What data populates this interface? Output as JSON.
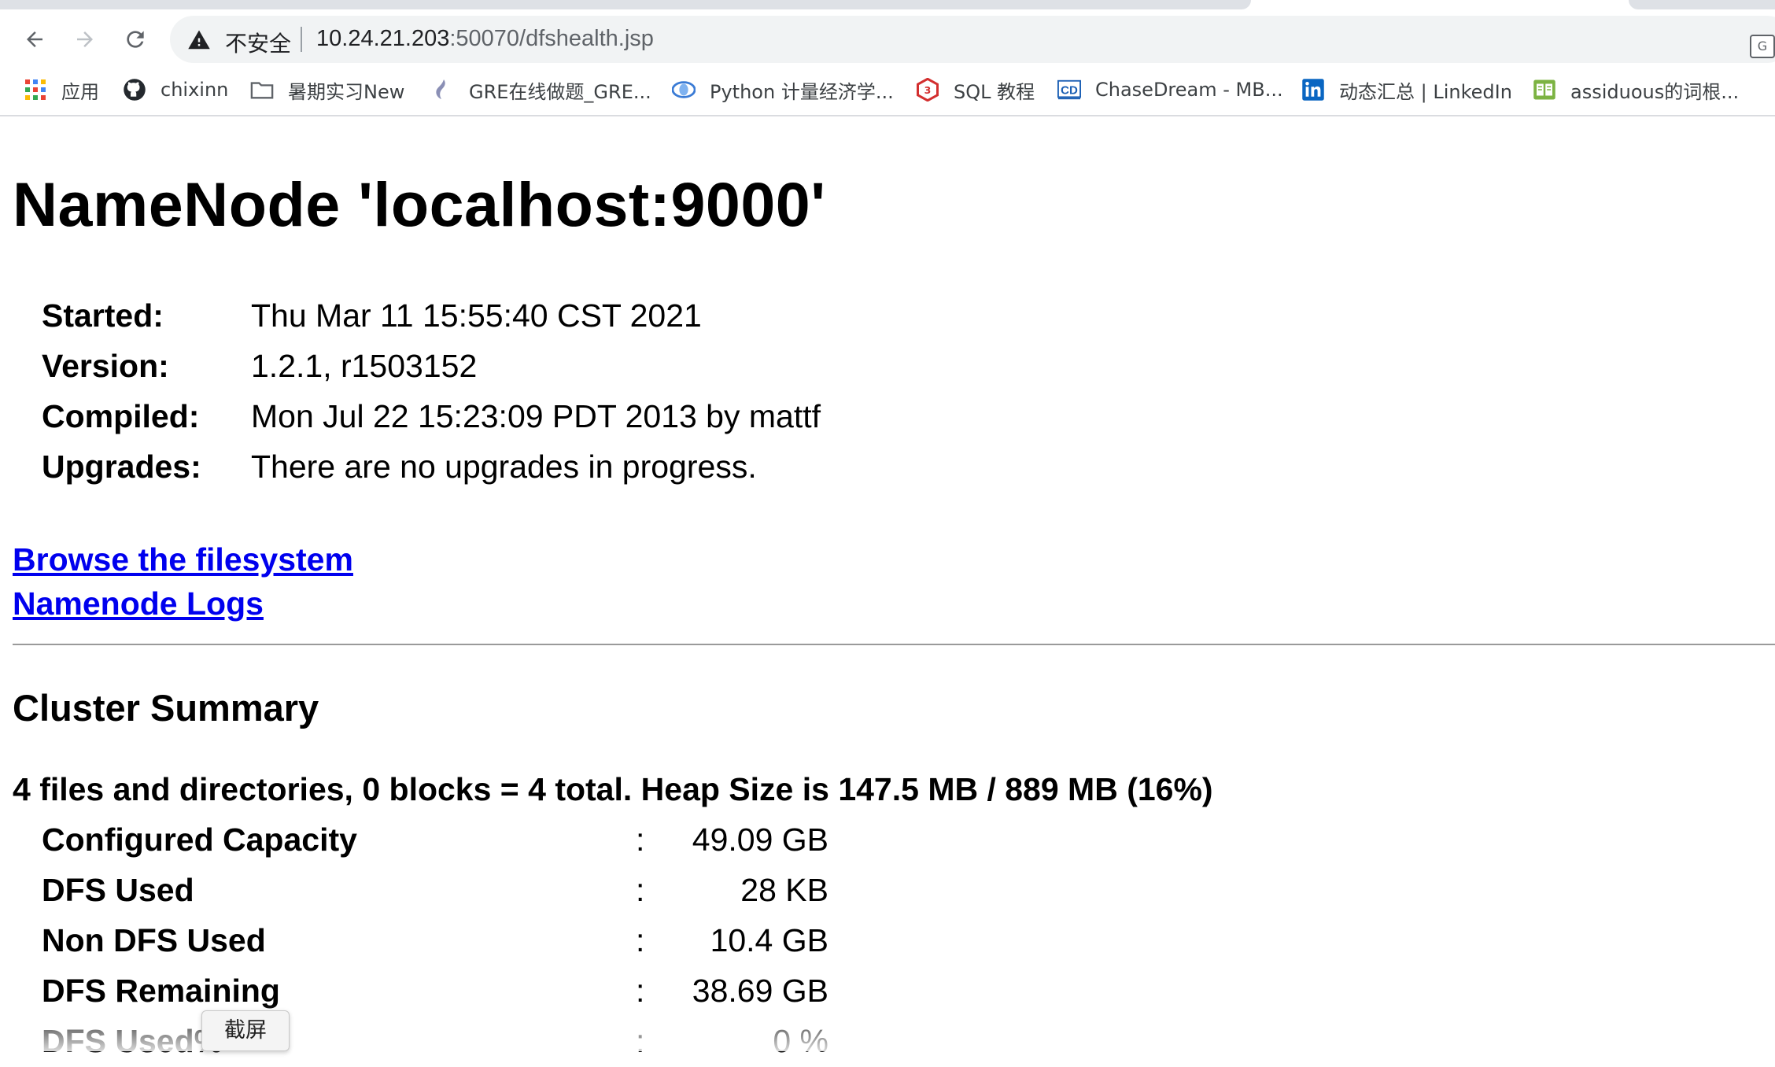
{
  "browser": {
    "insecure_label": "不安全",
    "url_host": "10.24.21.203",
    "url_rest": ":50070/dfshealth.jsp",
    "translate_label": "G文",
    "bookmarks": [
      {
        "icon": "apps-grid-icon",
        "label": "应用"
      },
      {
        "icon": "github-icon",
        "label": "chixinn"
      },
      {
        "icon": "folder-icon",
        "label": "暑期实习New"
      },
      {
        "icon": "gre-icon",
        "label": "GRE在线做题_GRE..."
      },
      {
        "icon": "python-icon",
        "label": "Python 计量经济学..."
      },
      {
        "icon": "sql-icon",
        "label": "SQL 教程"
      },
      {
        "icon": "chasedream-icon",
        "label": "ChaseDream - MB..."
      },
      {
        "icon": "linkedin-icon",
        "label": "动态汇总 | LinkedIn"
      },
      {
        "icon": "book-icon",
        "label": "assiduous的词根..."
      }
    ]
  },
  "page": {
    "title": "NameNode 'localhost:9000'",
    "info": [
      {
        "key": "Started:",
        "value": "Thu Mar 11 15:55:40 CST 2021"
      },
      {
        "key": "Version:",
        "value": "1.2.1, r1503152"
      },
      {
        "key": "Compiled:",
        "value": "Mon Jul 22 15:23:09 PDT 2013 by mattf"
      },
      {
        "key": "Upgrades:",
        "value": "There are no upgrades in progress."
      }
    ],
    "links": {
      "browse": "Browse the filesystem",
      "logs": "Namenode Logs"
    },
    "cluster": {
      "title": "Cluster Summary",
      "summary": "4 files and directories, 0 blocks = 4 total. Heap Size is 147.5 MB / 889 MB (16%)",
      "rows": [
        {
          "label": "Configured Capacity",
          "colon": ":",
          "value": "49.09 GB"
        },
        {
          "label": "DFS Used",
          "colon": ":",
          "value": "28 KB"
        },
        {
          "label": "Non DFS Used",
          "colon": ":",
          "value": "10.4 GB"
        },
        {
          "label": "DFS Remaining",
          "colon": ":",
          "value": "38.69 GB"
        },
        {
          "label": "DFS Used%",
          "colon": ":",
          "value": "0 %"
        }
      ]
    }
  },
  "overlay": {
    "tooltip": "截屏"
  },
  "colors": {
    "link": "#0000ee",
    "omnibox_bg": "#f1f3f4",
    "tabstrip_bg": "#dee1e6"
  }
}
